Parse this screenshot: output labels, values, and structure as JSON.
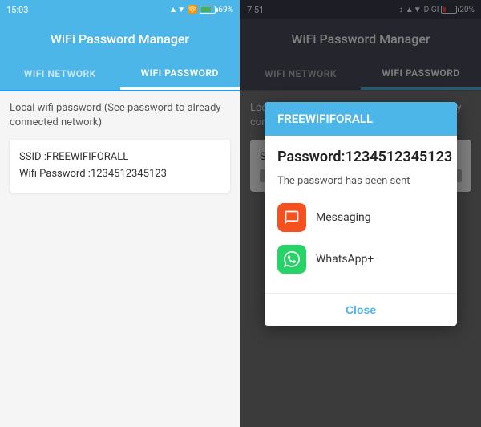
{
  "left": {
    "status_bar": {
      "time": "15:03",
      "signal": "▲▼",
      "wifi": "WiFi",
      "battery_percent": "69%"
    },
    "header": {
      "title": "WiFi Password Manager"
    },
    "tabs": [
      {
        "id": "wifi-network",
        "label": "WIFI NETWORK",
        "active": false
      },
      {
        "id": "wifi-password",
        "label": "WIFI PASSWORD",
        "active": true
      }
    ],
    "content": {
      "description": "Local wifi password (See password to already connected network)",
      "ssid_label": "SSID :FREEWIFIFORALL",
      "password_label": "Wifi Password :1234512345123"
    }
  },
  "right": {
    "status_bar": {
      "time": "7:51",
      "icons": "↕ ♦ ▲▼",
      "carrier": "DIGI",
      "battery_percent": "20%"
    },
    "header": {
      "title": "WiFi Password Manager"
    },
    "tabs": [
      {
        "id": "wifi-network",
        "label": "WIFI NETWORK",
        "active": false
      },
      {
        "id": "wifi-password",
        "label": "WIFI PASSWORD",
        "active": true
      }
    ],
    "content": {
      "description": "Local wifi password (See password to already connected network)",
      "ssid_label": "SSID :FREEWIFIFORALL",
      "password_label": "Wifi Password :1234512345123"
    },
    "dialog": {
      "title": "FREEWIFIFORALL",
      "password_display": "Password:1234512345123",
      "sent_text": "The password has been sent",
      "share_options": [
        {
          "id": "messaging",
          "label": "Messaging",
          "icon": "✉"
        },
        {
          "id": "whatsapp",
          "label": "WhatsApp+",
          "icon": "✓"
        }
      ],
      "close_label": "Close"
    }
  }
}
